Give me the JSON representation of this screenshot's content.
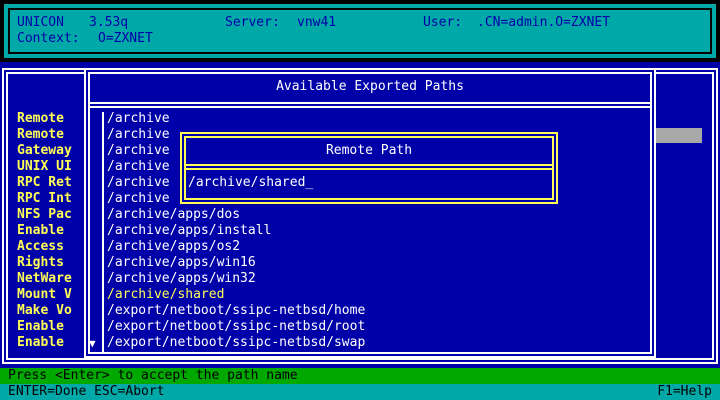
{
  "header": {
    "app": "UNICON",
    "version": "3.53q",
    "server_label": "Server:",
    "server": "vnw41",
    "user_label": "User:",
    "user": ".CN=admin.O=ZXNET",
    "context_label": "Context:",
    "context": "O=ZXNET"
  },
  "menu": {
    "items": [
      "Remote",
      "Remote",
      "Gateway",
      "UNIX UI",
      "RPC Ret",
      "RPC Int",
      "NFS Pac",
      "Enable",
      "Access",
      "Rights",
      "NetWare",
      "Mount V",
      "Make Vo",
      "Enable",
      "Enable"
    ]
  },
  "dialog": {
    "title": "Available Exported Paths",
    "scroll_arrow": "▼",
    "paths": [
      "/archive",
      "/archive",
      "/archive",
      "/archive",
      "/archive",
      "/archive",
      "/archive/apps/dos",
      "/archive/apps/install",
      "/archive/apps/os2",
      "/archive/apps/win16",
      "/archive/apps/win32",
      "/archive/shared",
      "/export/netboot/ssipc-netbsd/home",
      "/export/netboot/ssipc-netbsd/root",
      "/export/netboot/ssipc-netbsd/swap"
    ],
    "selected_index": 11
  },
  "popup": {
    "title": "Remote Path",
    "value": "/archive/shared_"
  },
  "footer": {
    "status": "Press <Enter> to accept the path name",
    "keys": "ENTER=Done ESC=Abort",
    "help": "F1=Help"
  },
  "colors": {
    "background": "#0000a8",
    "header": "#00a8a8",
    "highlight": "#ffff55",
    "status_bar": "#00a800"
  }
}
